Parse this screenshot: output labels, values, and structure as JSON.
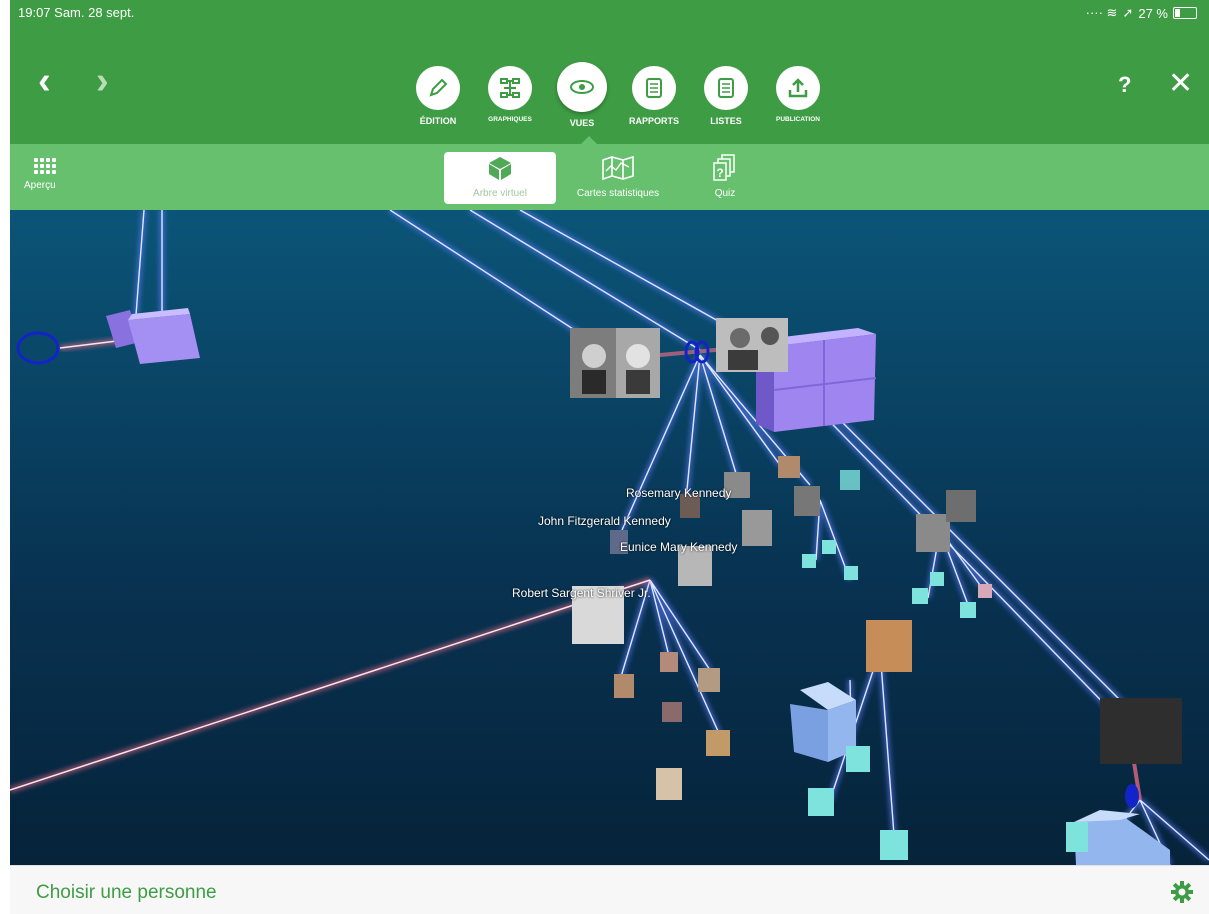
{
  "status_bar": {
    "time_date": "19:07  Sam. 28 sept.",
    "battery": "27 %"
  },
  "main_menu": [
    {
      "label": "ÉDITION",
      "icon": "pencil-icon"
    },
    {
      "label": "GRAPHIQUES",
      "icon": "tree-chart-icon"
    },
    {
      "label": "VUES",
      "icon": "eye-icon",
      "active": true
    },
    {
      "label": "RAPPORTS",
      "icon": "document-icon"
    },
    {
      "label": "LISTES",
      "icon": "list-icon"
    },
    {
      "label": "PUBLICATION",
      "icon": "upload-icon"
    }
  ],
  "header": {
    "help": "?",
    "close": "✕"
  },
  "sub_menu": {
    "apercu": "Aperçu",
    "tabs": [
      {
        "label": "Arbre virtuel",
        "icon": "cube-icon",
        "active": true
      },
      {
        "label": "Cartes statistiques",
        "icon": "map-icon"
      },
      {
        "label": "Quiz",
        "icon": "quiz-cards-icon"
      }
    ]
  },
  "scene": {
    "people": [
      "Rosemary Kennedy",
      "John Fitzgerald Kennedy",
      "Eunice Mary Kennedy",
      "Robert Sargent Shriver Jr."
    ]
  },
  "bottom_bar": {
    "choose_person": "Choisir une personne",
    "settings_icon": "gear-icon"
  },
  "colors": {
    "primary_green": "#3e9d44",
    "light_green": "#67c06e",
    "scene_bg": "#083352",
    "link_blue": "#6a86ff",
    "link_red": "#ff8fa5",
    "cube_purple": "#9e85f0",
    "cube_blue": "#93b6ee",
    "cube_cyan": "#7fe3dd"
  }
}
